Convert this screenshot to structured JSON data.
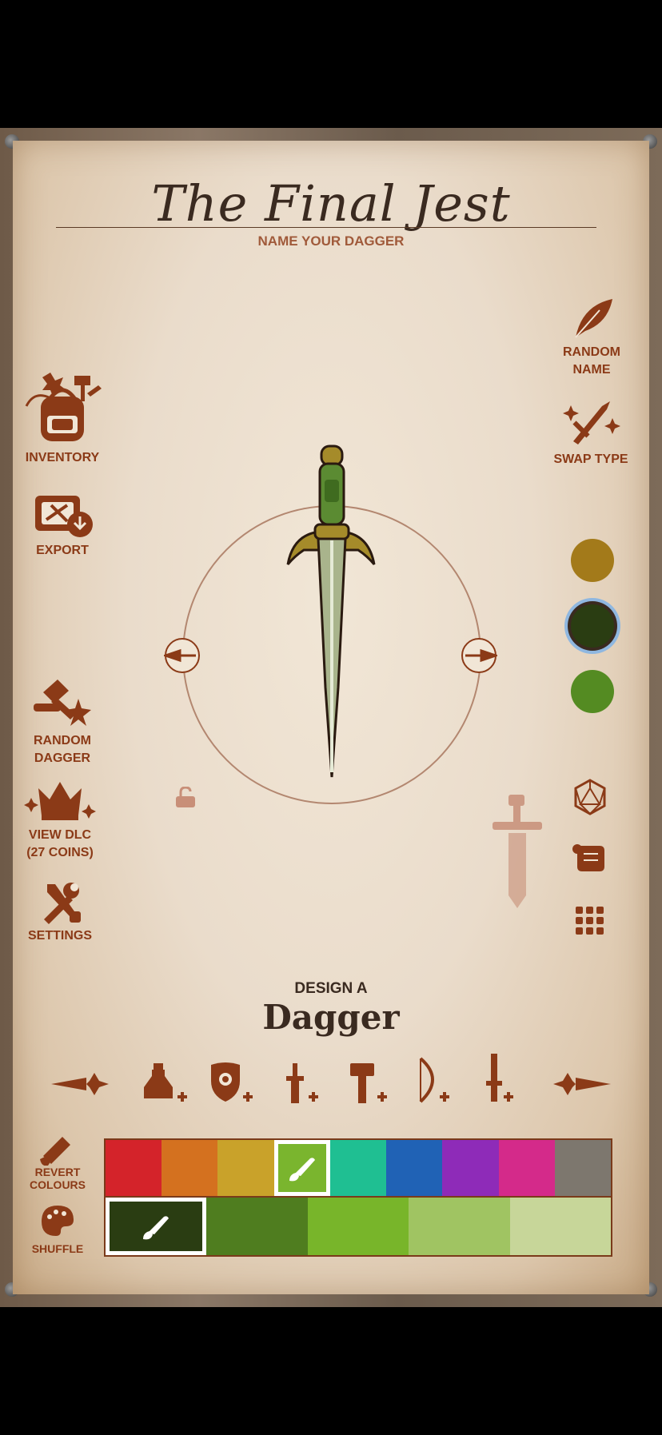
{
  "header": {
    "title": "The Final Jest",
    "subtitle": "NAME YOUR DAGGER"
  },
  "left_menu": {
    "inventory": "INVENTORY",
    "export": "EXPORT",
    "random_dagger_1": "RANDOM",
    "random_dagger_2": "DAGGER",
    "view_dlc_1": "VIEW DLC",
    "view_dlc_2": "(27 COINS)",
    "settings": "SETTINGS"
  },
  "right_menu": {
    "random_name_1": "RANDOM",
    "random_name_2": "NAME",
    "swap_type": "SWAP TYPE"
  },
  "color_dots": [
    "#a37a1a",
    "#2a3d12",
    "#548b22"
  ],
  "design": {
    "prefix": "DESIGN A",
    "type": "Dagger"
  },
  "bottom_left": {
    "revert_1": "REVERT",
    "revert_2": "COLOURS",
    "shuffle": "SHUFFLE"
  },
  "palette": {
    "hues": [
      "#d4232a",
      "#d4711f",
      "#c9a22a",
      "#7ab52e",
      "#1fbf92",
      "#2062b5",
      "#8e2bb8",
      "#d42a8a",
      "#7d776e"
    ],
    "shades": [
      "#2a3d12",
      "#4f7d1f",
      "#78b52a",
      "#a0c462",
      "#c7d699"
    ],
    "selected_hue_index": 3,
    "selected_shade_index": 0
  },
  "icons": {
    "weapon_types": [
      "potion-plus-icon",
      "shield-plus-icon",
      "sword-plus-icon",
      "hammer-plus-icon",
      "bow-plus-icon",
      "dagger-plus-icon"
    ]
  }
}
